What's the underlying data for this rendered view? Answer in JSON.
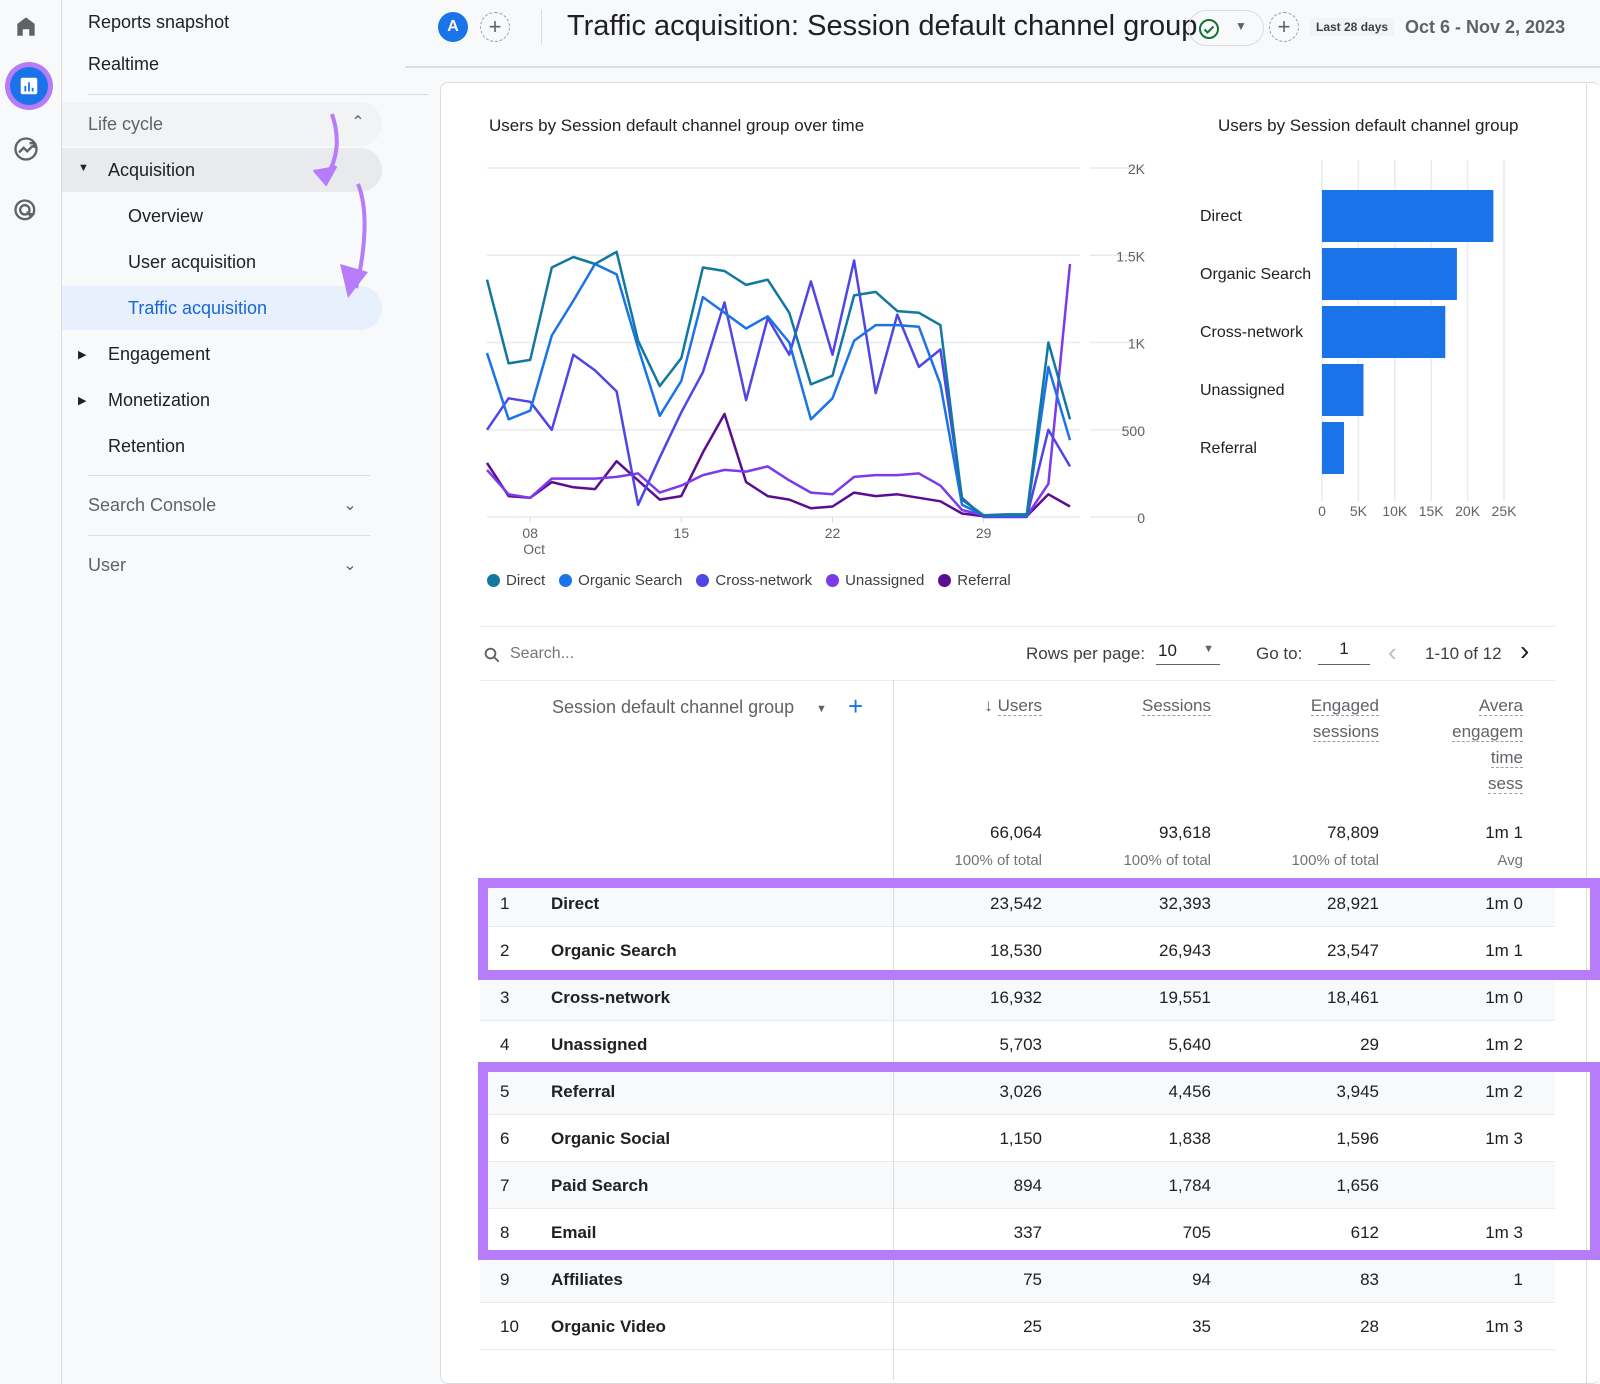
{
  "rail": {
    "icons": [
      "home-icon",
      "reports-icon",
      "explore-icon",
      "advertising-icon"
    ]
  },
  "nav": {
    "reports_snapshot": "Reports snapshot",
    "realtime": "Realtime",
    "lifecycle": "Life cycle",
    "acquisition": "Acquisition",
    "overview": "Overview",
    "user_acquisition": "User acquisition",
    "traffic_acquisition": "Traffic acquisition",
    "engagement": "Engagement",
    "monetization": "Monetization",
    "retention": "Retention",
    "search_console": "Search Console",
    "user": "User"
  },
  "header": {
    "avatar_letter": "A",
    "title": "Traffic acquisition: Session default channel group",
    "date_preset": "Last 28 days",
    "date_range": "Oct 6 - Nov 2, 2023"
  },
  "colors": {
    "accent": "#1a73e8",
    "highlight": "#b67cf9",
    "direct": "#12789f",
    "organic_search": "#1a73e8",
    "cross_network": "#4f46e5",
    "unassigned": "#7c3aed",
    "referral": "#5b0e91"
  },
  "chart_data": [
    {
      "type": "line",
      "title": "Users by Session default channel group over time",
      "xlabel": "",
      "ylabel": "",
      "x_ticks": [
        "08\nOct",
        "15",
        "22",
        "29"
      ],
      "x_tick_days": [
        2,
        9,
        16,
        23
      ],
      "y_ticks": [
        "0",
        "500",
        "1K",
        "1.5K",
        "2K"
      ],
      "ylim": [
        0,
        2000
      ],
      "x": [
        "Oct 6",
        "Oct 7",
        "Oct 8",
        "Oct 9",
        "Oct 10",
        "Oct 11",
        "Oct 12",
        "Oct 13",
        "Oct 14",
        "Oct 15",
        "Oct 16",
        "Oct 17",
        "Oct 18",
        "Oct 19",
        "Oct 20",
        "Oct 21",
        "Oct 22",
        "Oct 23",
        "Oct 24",
        "Oct 25",
        "Oct 26",
        "Oct 27",
        "Oct 28",
        "Oct 29",
        "Oct 30",
        "Oct 31",
        "Nov 1",
        "Nov 2"
      ],
      "series": [
        {
          "name": "Direct",
          "values": [
            1360,
            880,
            900,
            1430,
            1490,
            1450,
            1520,
            1010,
            750,
            910,
            1430,
            1410,
            1330,
            1360,
            1170,
            760,
            810,
            1270,
            1290,
            1180,
            1170,
            1100,
            100,
            10,
            15,
            15,
            1000,
            560
          ]
        },
        {
          "name": "Organic Search",
          "values": [
            940,
            560,
            610,
            1040,
            1240,
            1450,
            1390,
            970,
            580,
            780,
            1260,
            1170,
            1080,
            1150,
            1000,
            560,
            680,
            1010,
            1100,
            1100,
            1090,
            760,
            70,
            10,
            10,
            10,
            860,
            440
          ]
        },
        {
          "name": "Cross-network",
          "values": [
            500,
            680,
            660,
            500,
            930,
            840,
            720,
            70,
            340,
            600,
            830,
            1230,
            670,
            1140,
            930,
            1350,
            930,
            1470,
            710,
            1160,
            860,
            960,
            110,
            0,
            0,
            0,
            500,
            290
          ]
        },
        {
          "name": "Unassigned",
          "values": [
            270,
            130,
            110,
            220,
            220,
            220,
            230,
            250,
            140,
            180,
            240,
            270,
            260,
            290,
            210,
            140,
            130,
            230,
            240,
            240,
            250,
            180,
            40,
            10,
            5,
            5,
            190,
            1450
          ]
        },
        {
          "name": "Referral",
          "values": [
            310,
            120,
            110,
            200,
            170,
            160,
            320,
            210,
            100,
            120,
            370,
            590,
            200,
            120,
            100,
            50,
            60,
            140,
            120,
            130,
            110,
            90,
            20,
            5,
            5,
            5,
            130,
            60
          ]
        }
      ],
      "legend": [
        "Direct",
        "Organic Search",
        "Cross-network",
        "Unassigned",
        "Referral"
      ],
      "legend_position": "bottom",
      "grid": true
    },
    {
      "type": "bar",
      "orientation": "horizontal",
      "title": "Users by Session default channel group",
      "categories": [
        "Direct",
        "Organic Search",
        "Cross-network",
        "Unassigned",
        "Referral"
      ],
      "values": [
        23542,
        18530,
        16932,
        5703,
        3026
      ],
      "x_ticks": [
        "0",
        "5K",
        "10K",
        "15K",
        "20K",
        "25K"
      ],
      "xlim": [
        0,
        25000
      ],
      "grid": true
    }
  ],
  "toolbar": {
    "search_placeholder": "Search...",
    "rows_per_page_label": "Rows per page:",
    "rows_per_page_value": "10",
    "goto_label": "Go to:",
    "goto_value": "1",
    "pagination_text": "1-10 of 12"
  },
  "table": {
    "dimension_header": "Session default channel group",
    "columns": [
      {
        "label_lines": [
          "Users"
        ],
        "sorted": true
      },
      {
        "label_lines": [
          "Sessions"
        ]
      },
      {
        "label_lines": [
          "Engaged",
          "sessions"
        ]
      },
      {
        "label_lines": [
          "Avera",
          "engagem",
          "time",
          "sess"
        ]
      }
    ],
    "totals": [
      "66,064",
      "93,618",
      "78,809",
      "1m 1"
    ],
    "totals_sub": [
      "100% of total",
      "100% of total",
      "100% of total",
      "Avg"
    ],
    "rows": [
      {
        "rank": "1",
        "channel": "Direct",
        "users": "23,542",
        "sessions": "32,393",
        "engaged": "28,921",
        "avg": "1m 0"
      },
      {
        "rank": "2",
        "channel": "Organic Search",
        "users": "18,530",
        "sessions": "26,943",
        "engaged": "23,547",
        "avg": "1m 1"
      },
      {
        "rank": "3",
        "channel": "Cross-network",
        "users": "16,932",
        "sessions": "19,551",
        "engaged": "18,461",
        "avg": "1m 0"
      },
      {
        "rank": "4",
        "channel": "Unassigned",
        "users": "5,703",
        "sessions": "5,640",
        "engaged": "29",
        "avg": "1m 2"
      },
      {
        "rank": "5",
        "channel": "Referral",
        "users": "3,026",
        "sessions": "4,456",
        "engaged": "3,945",
        "avg": "1m 2"
      },
      {
        "rank": "6",
        "channel": "Organic Social",
        "users": "1,150",
        "sessions": "1,838",
        "engaged": "1,596",
        "avg": "1m 3"
      },
      {
        "rank": "7",
        "channel": "Paid Search",
        "users": "894",
        "sessions": "1,784",
        "engaged": "1,656",
        "avg": ""
      },
      {
        "rank": "8",
        "channel": "Email",
        "users": "337",
        "sessions": "705",
        "engaged": "612",
        "avg": "1m 3"
      },
      {
        "rank": "9",
        "channel": "Affiliates",
        "users": "75",
        "sessions": "94",
        "engaged": "83",
        "avg": "1"
      },
      {
        "rank": "10",
        "channel": "Organic Video",
        "users": "25",
        "sessions": "35",
        "engaged": "28",
        "avg": "1m 3"
      }
    ]
  }
}
